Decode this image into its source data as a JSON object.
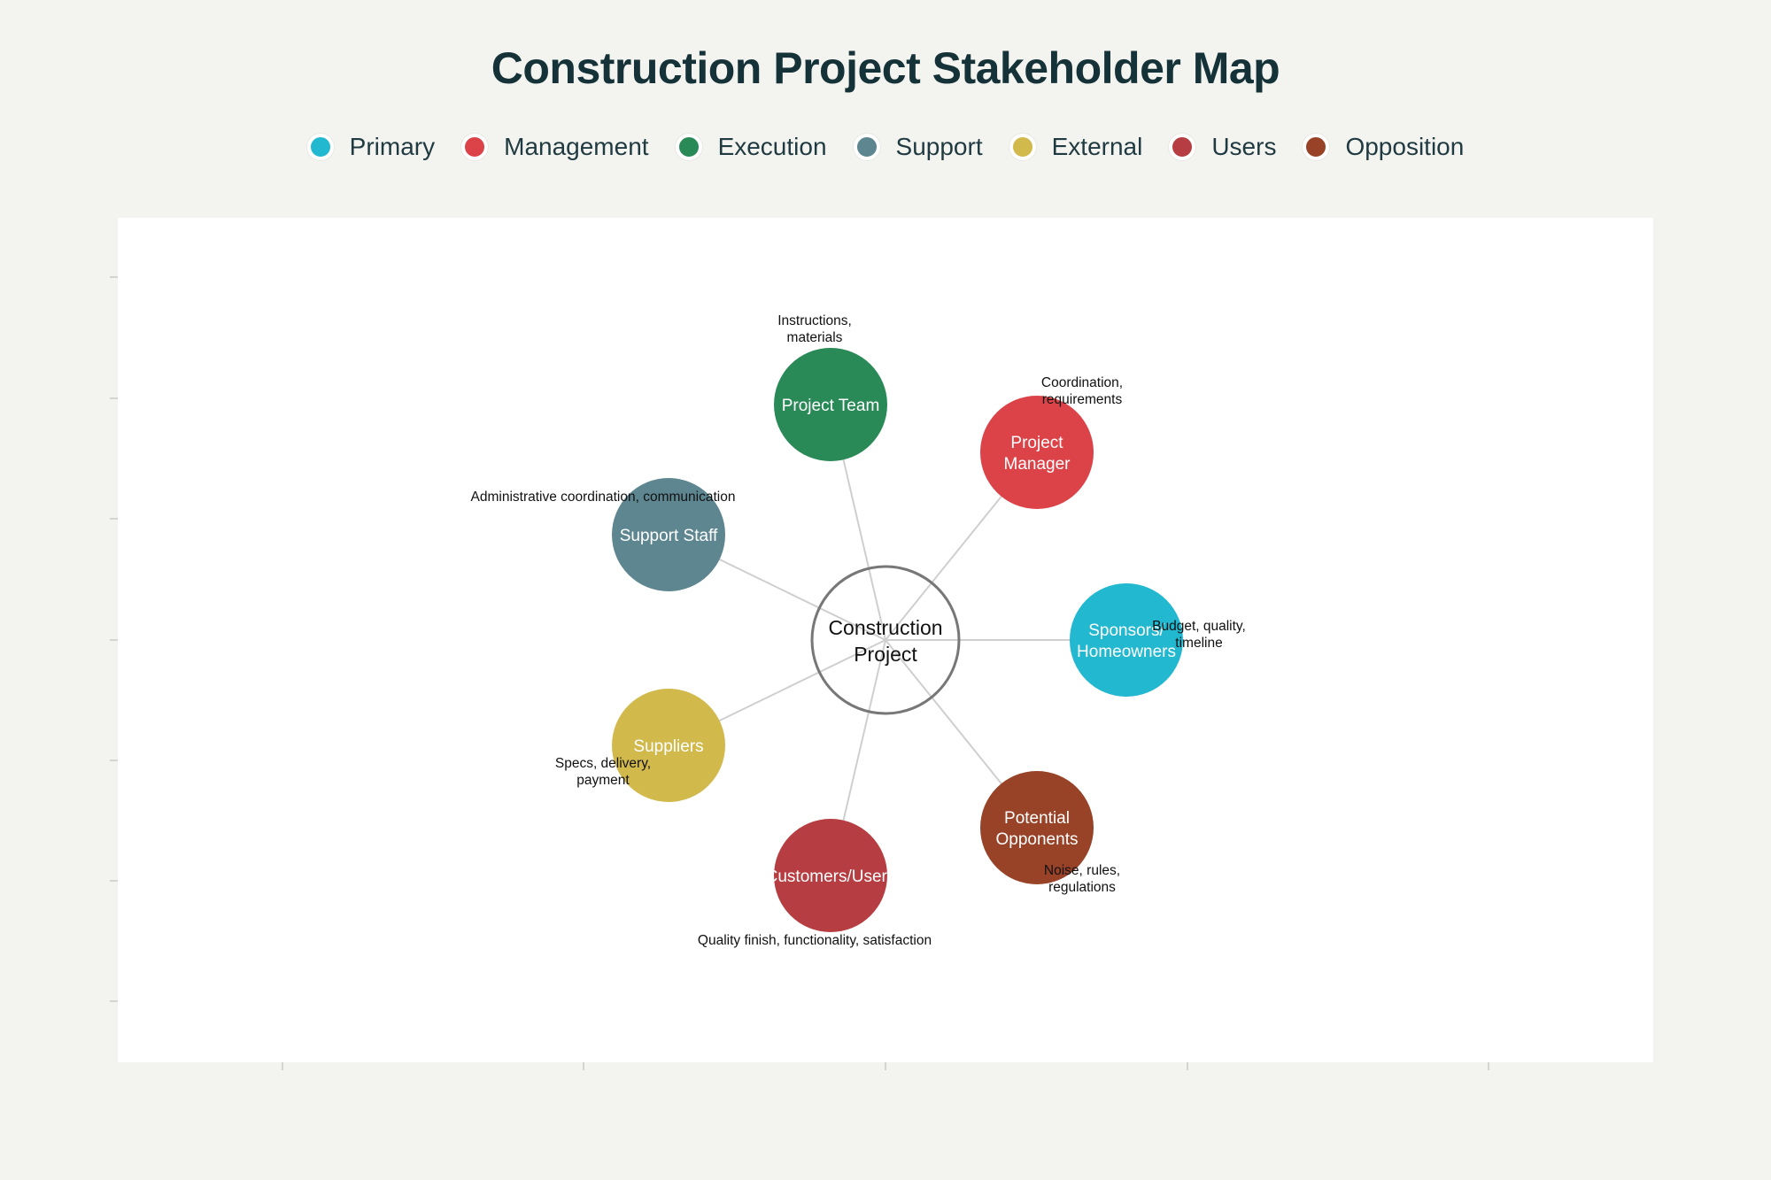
{
  "title": "Construction Project Stakeholder Map",
  "legend": [
    {
      "label": "Primary",
      "color": "#22b8d0"
    },
    {
      "label": "Management",
      "color": "#dc4349"
    },
    {
      "label": "Execution",
      "color": "#2a8a57"
    },
    {
      "label": "Support",
      "color": "#5e8690"
    },
    {
      "label": "External",
      "color": "#d1b94c"
    },
    {
      "label": "Users",
      "color": "#b63e42"
    },
    {
      "label": "Opposition",
      "color": "#984228"
    }
  ],
  "center": {
    "lines": [
      "Construction",
      "Project"
    ]
  },
  "stakeholders": [
    {
      "id": "project-team",
      "lines": [
        "Project Team"
      ],
      "category": "Execution",
      "color": "#2a8a57",
      "note": [
        "Instructions,",
        "materials"
      ]
    },
    {
      "id": "project-manager",
      "lines": [
        "Project",
        "Manager"
      ],
      "category": "Management",
      "color": "#dc4349",
      "note": [
        "Coordination,",
        "requirements"
      ]
    },
    {
      "id": "sponsors-homeowners",
      "lines": [
        "Sponsors/",
        "Homeowners"
      ],
      "category": "Primary",
      "color": "#22b8d0",
      "note": [
        "Budget, quality,",
        "timeline"
      ]
    },
    {
      "id": "potential-opponents",
      "lines": [
        "Potential",
        "Opponents"
      ],
      "category": "Opposition",
      "color": "#984228",
      "note": [
        "Noise, rules,",
        "regulations"
      ]
    },
    {
      "id": "customers-users",
      "lines": [
        "Customers/Users"
      ],
      "category": "Users",
      "color": "#b63e42",
      "note": [
        "Quality finish, functionality, satisfaction"
      ]
    },
    {
      "id": "suppliers",
      "lines": [
        "Suppliers"
      ],
      "category": "External",
      "color": "#d1b94c",
      "note": [
        "Specs, delivery,",
        "payment"
      ]
    },
    {
      "id": "support-staff",
      "lines": [
        "Support Staff"
      ],
      "category": "Support",
      "color": "#5e8690",
      "note": [
        "Administrative coordination, communication"
      ]
    }
  ]
}
